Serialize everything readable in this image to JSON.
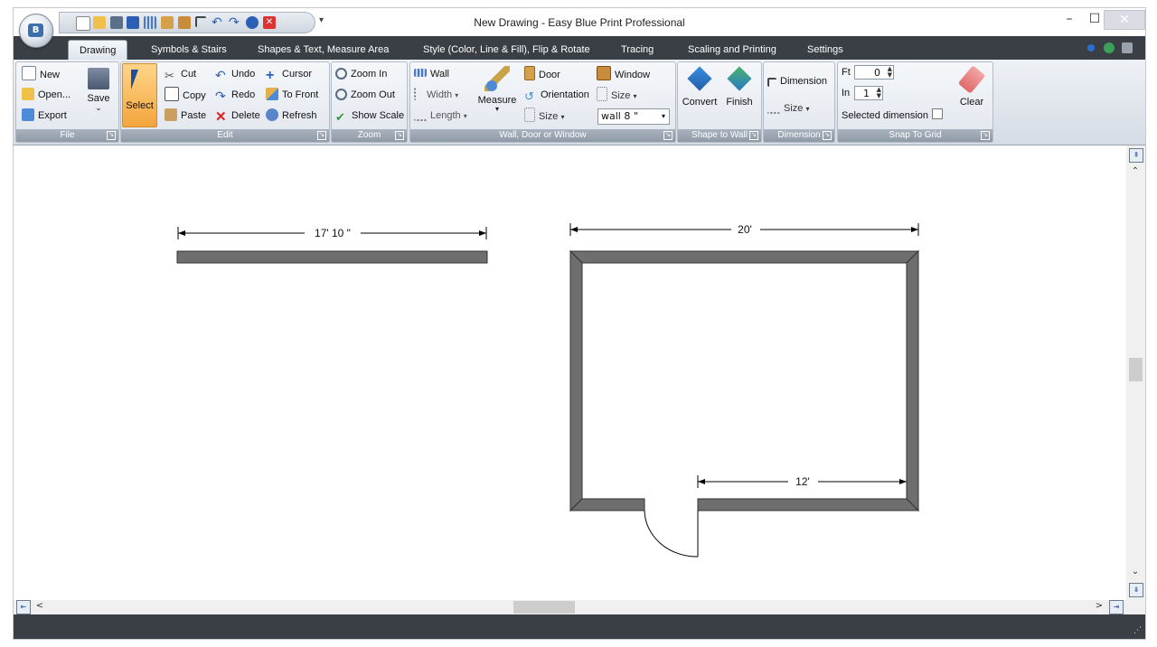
{
  "window": {
    "title": "New Drawing - Easy Blue Print Professional",
    "minimize": "–",
    "maximize": "☐",
    "close": "✕",
    "qat_more": "▾"
  },
  "tabs": [
    {
      "label": "Drawing",
      "active": true
    },
    {
      "label": "Symbols & Stairs"
    },
    {
      "label": "Shapes & Text, Measure Area"
    },
    {
      "label": "Style (Color, Line & Fill), Flip & Rotate"
    },
    {
      "label": "Tracing"
    },
    {
      "label": "Scaling and Printing"
    },
    {
      "label": "Settings"
    }
  ],
  "ribbon": {
    "file": {
      "label": "File",
      "new": "New",
      "open": "Open...",
      "export": "Export",
      "save": "Save",
      "save_arrow": "⌄"
    },
    "edit": {
      "label": "Edit",
      "select": "Select",
      "cut": "Cut",
      "copy": "Copy",
      "paste": "Paste",
      "undo": "Undo",
      "redo": "Redo",
      "delete": "Delete",
      "cursor": "Cursor",
      "to_front": "To Front",
      "refresh": "Refresh"
    },
    "zoom": {
      "label": "Zoom",
      "zoom_in": "Zoom In",
      "zoom_out": "Zoom Out",
      "show_scale": "Show Scale"
    },
    "wall": {
      "label": "Wall, Door or Window",
      "wall": "Wall",
      "width": "Width",
      "length": "Length",
      "measure": "Measure",
      "door": "Door",
      "orientation": "Orientation",
      "size": "Size",
      "window": "Window",
      "window_size": "Size",
      "wall_select": "wall 8 \""
    },
    "shape_to_wall": {
      "label": "Shape to Wall",
      "convert": "Convert",
      "finish": "Finish"
    },
    "dimension": {
      "label": "Dimension",
      "dimension": "Dimension",
      "size": "Size"
    },
    "snap": {
      "label": "Snap To Grid",
      "ft_label": "Ft",
      "ft_value": "0",
      "in_label": "In",
      "in_value": "1",
      "selected_dimension": "Selected dimension",
      "clear": "Clear"
    }
  },
  "drawing": {
    "dim_top_left": "17' 10 \"",
    "dim_room_width": "20'",
    "dim_inner": "12'"
  },
  "colors": {
    "accent_select": "#f3a53d",
    "dark_strip": "#3a3f45",
    "wall_fill": "#6e6e6e"
  }
}
